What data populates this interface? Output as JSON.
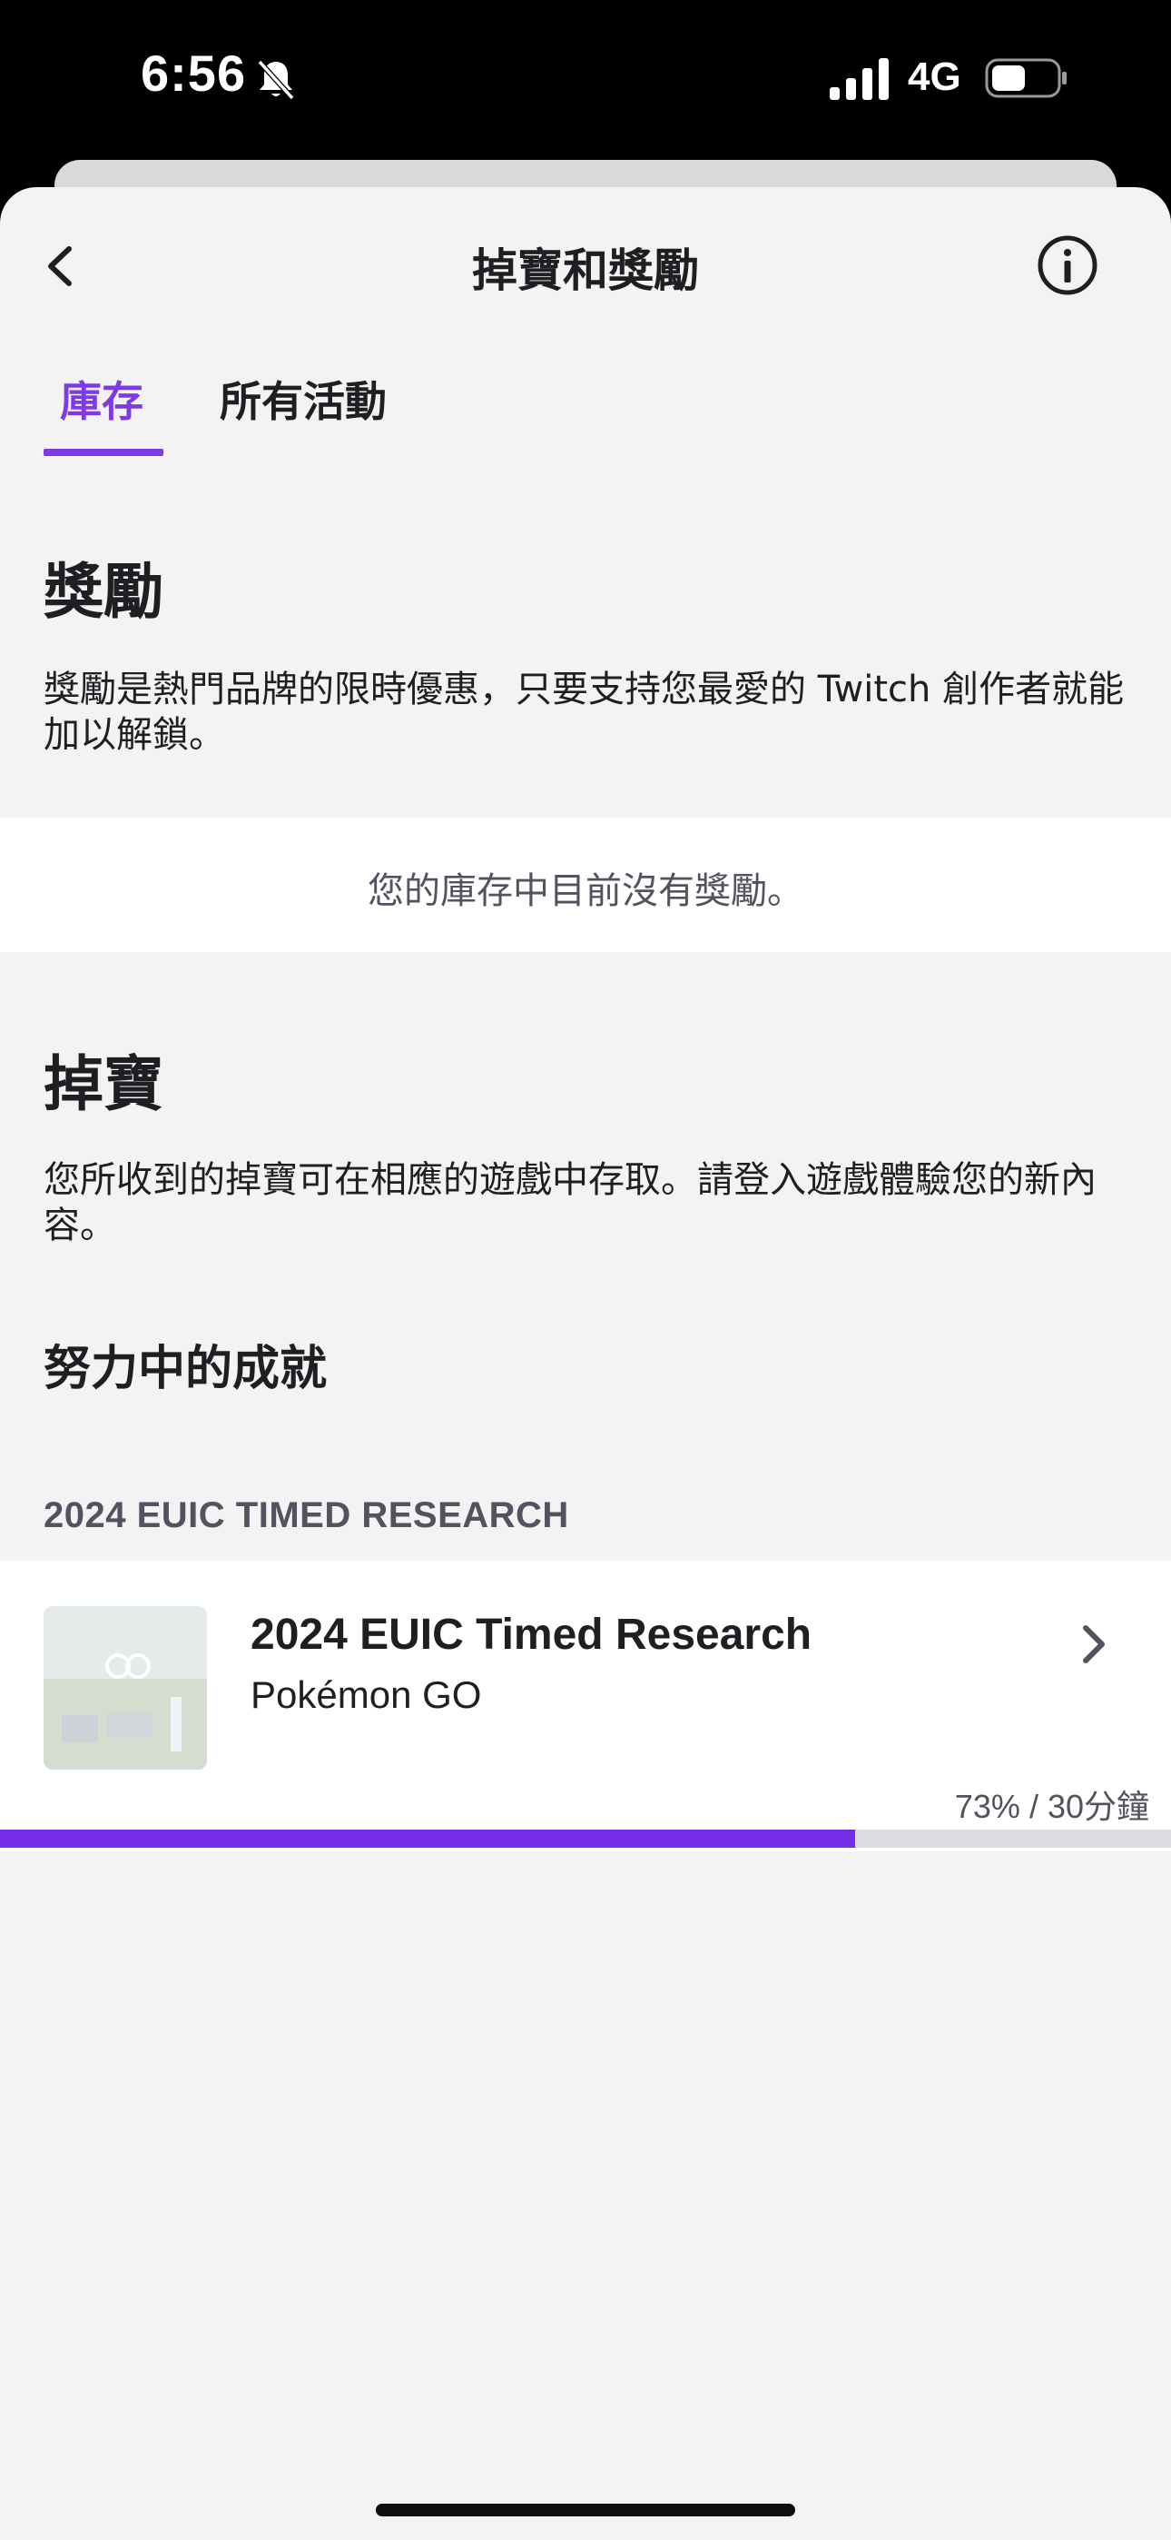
{
  "status_bar": {
    "time": "6:56",
    "network": "4G",
    "icons": [
      "bell-slash-icon",
      "signal-icon",
      "battery-icon"
    ]
  },
  "nav": {
    "title": "掉寶和獎勵",
    "back_icon": "chevron-left-icon",
    "info_icon": "info-icon"
  },
  "tabs": [
    {
      "label": "庫存",
      "active": true
    },
    {
      "label": "所有活動",
      "active": false
    }
  ],
  "rewards": {
    "title": "獎勵",
    "description": "獎勵是熱門品牌的限時優惠，只要支持您最愛的 Twitch 創作者就能加以解鎖。",
    "empty_message": "您的庫存中目前沒有獎勵。"
  },
  "drops": {
    "title": "掉寶",
    "description": "您所收到的掉寶可在相應的遊戲中存取。請登入遊戲體驗您的新內容。",
    "in_progress_heading": "努力中的成就",
    "group_header": "2024 EUIC TIMED RESEARCH",
    "campaign": {
      "name": "2024 EUIC Timed Research",
      "game": "Pokémon GO",
      "progress_text": "73% / 30分鐘",
      "progress": 0.73
    }
  },
  "colors": {
    "accent": "#772ce8",
    "background": "#f3f3f4",
    "card": "#ffffff"
  }
}
